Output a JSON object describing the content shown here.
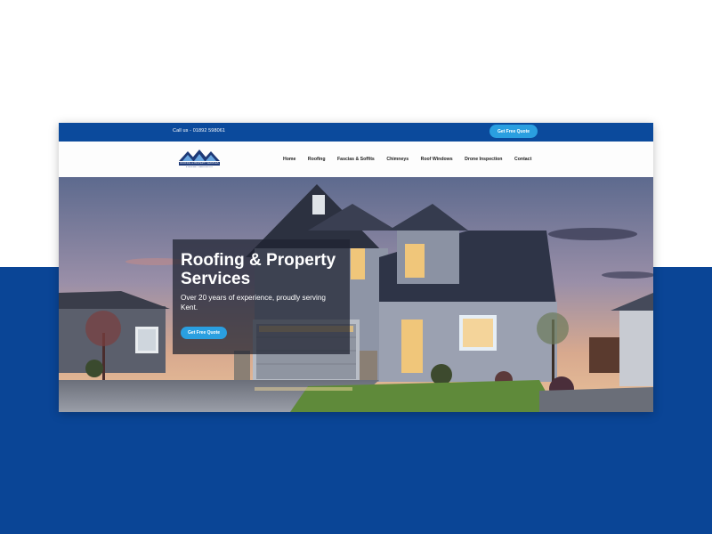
{
  "topbar": {
    "call_text": "Call us - 01892 598061",
    "quote_button": "Get Free Quote"
  },
  "logo": {
    "name": "ROOFING & PROPERTY SERVICES",
    "sub": "& PROPERTY SERVICES LTD"
  },
  "nav": {
    "items": [
      {
        "label": "Home"
      },
      {
        "label": "Roofing"
      },
      {
        "label": "Fascias & Soffits"
      },
      {
        "label": "Chimneys"
      },
      {
        "label": "Roof Windows"
      },
      {
        "label": "Drone Inspection"
      },
      {
        "label": "Contact"
      }
    ]
  },
  "hero": {
    "title": "Roofing & Property Services",
    "subtitle": "Over 20 years of experience, proudly serving Kent.",
    "cta": "Get Free Quote"
  },
  "colors": {
    "brand_blue": "#0b4a9c",
    "accent": "#2a9fe0",
    "page_blue": "#0a4596"
  }
}
